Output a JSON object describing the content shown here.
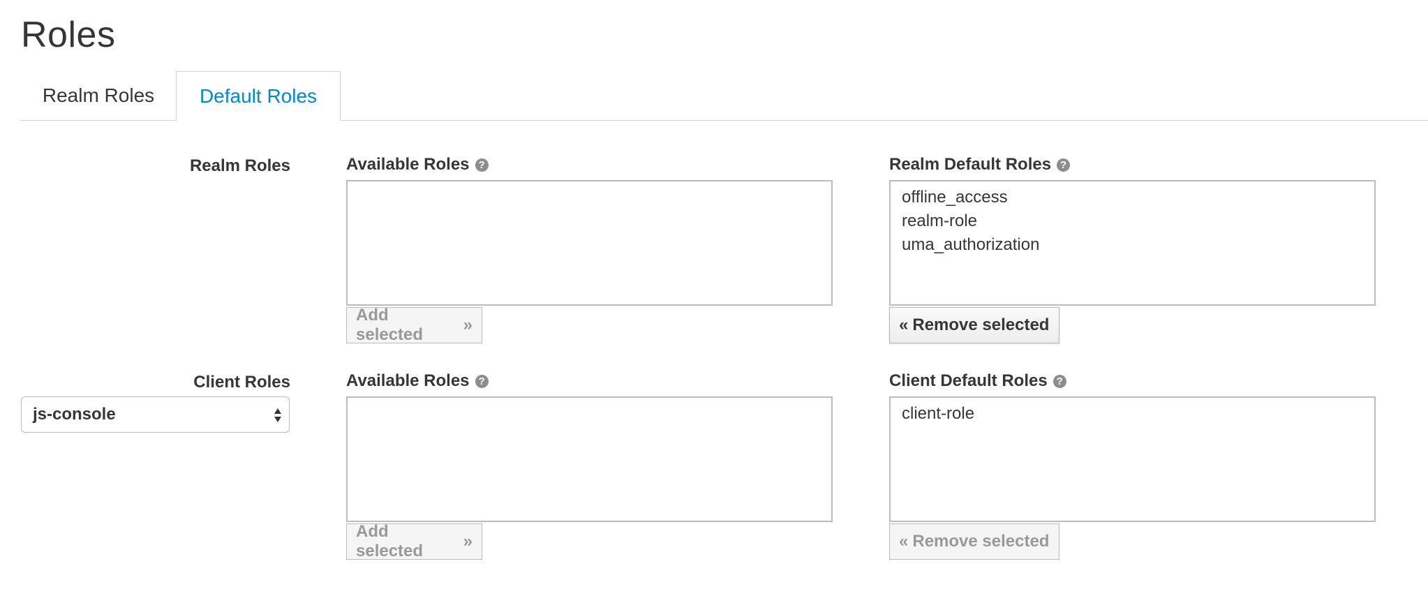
{
  "page": {
    "title": "Roles"
  },
  "tabs": [
    {
      "label": "Realm Roles",
      "active": false
    },
    {
      "label": "Default Roles",
      "active": true
    }
  ],
  "realm_roles": {
    "row_label": "Realm Roles",
    "available": {
      "label": "Available Roles",
      "items": []
    },
    "default": {
      "label": "Realm Default Roles",
      "items": [
        "offline_access",
        "realm-role",
        "uma_authorization"
      ]
    },
    "add_label": "Add selected",
    "remove_label": "Remove selected"
  },
  "client_roles": {
    "row_label": "Client Roles",
    "client_select": {
      "value": "js-console"
    },
    "available": {
      "label": "Available Roles",
      "items": []
    },
    "default": {
      "label": "Client Default Roles",
      "items": [
        "client-role"
      ]
    },
    "add_label": "Add selected",
    "remove_label": "Remove selected"
  },
  "colors": {
    "accent": "#0088ce",
    "text": "#363636",
    "disabled_text": "#999999"
  }
}
